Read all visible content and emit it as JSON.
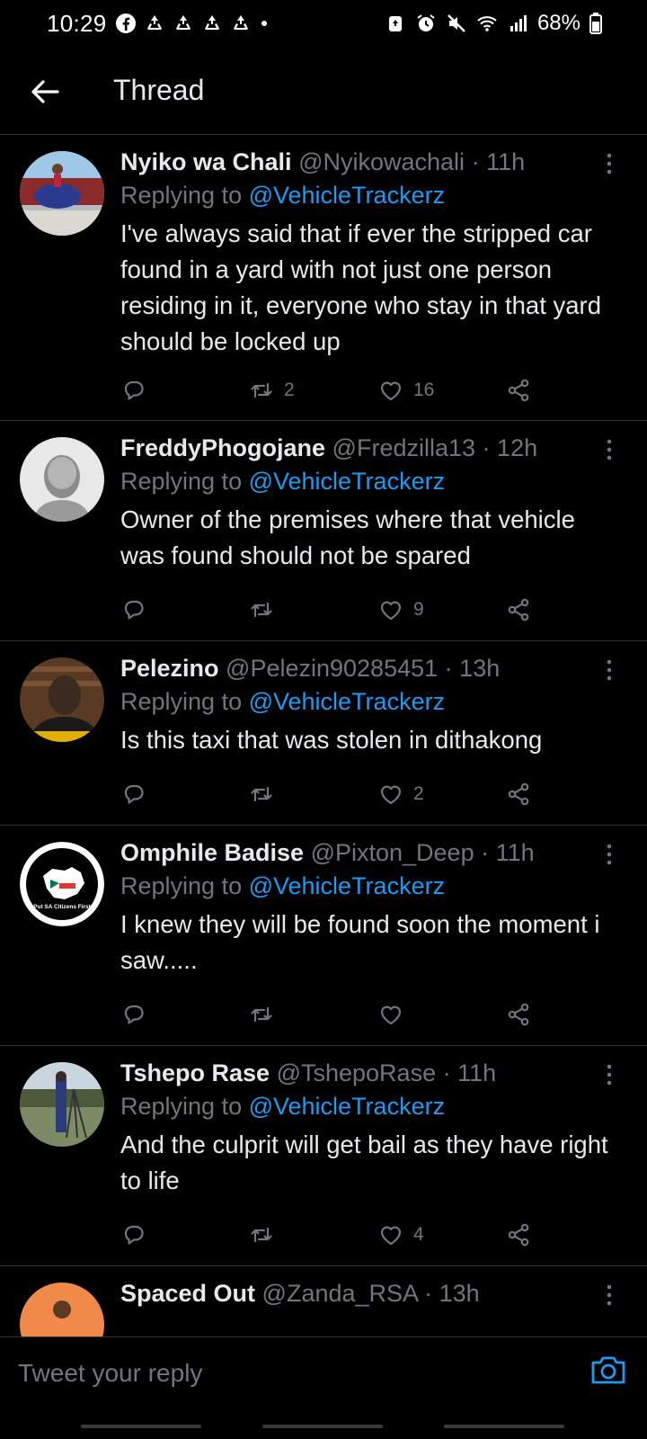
{
  "status_bar": {
    "time": "10:29",
    "battery": "68%",
    "left_icons": [
      "facebook-icon",
      "recycle-icon",
      "recycle-icon",
      "recycle-icon",
      "recycle-icon",
      "dot-icon"
    ],
    "right_icons": [
      "battery-saver-icon",
      "alarm-icon",
      "mute-icon",
      "wifi-icon",
      "signal-icon",
      "battery-icon"
    ]
  },
  "header": {
    "title": "Thread"
  },
  "tweets": [
    {
      "name": "Nyiko wa Chali",
      "handle": "@Nyikowachali",
      "sep": "·",
      "time": "11h",
      "replying_prefix": "Replying to ",
      "replying_to": "@VehicleTrackerz",
      "text": "I've always said that if ever the stripped car found in a yard with not just one person residing in it, everyone who stay in that yard should be locked up",
      "retweets": "2",
      "likes": "16"
    },
    {
      "name": "FreddyPhogojane",
      "handle": "@Fredzilla13",
      "sep": "·",
      "time": "12h",
      "replying_prefix": "Replying to ",
      "replying_to": "@VehicleTrackerz",
      "text": "Owner of the premises where that vehicle was found should not be spared",
      "retweets": "",
      "likes": "9"
    },
    {
      "name": "Pelezino",
      "handle": "@Pelezin90285451",
      "sep": "·",
      "time": "13h",
      "replying_prefix": "Replying to ",
      "replying_to": "@VehicleTrackerz",
      "text": "Is this taxi that was stolen in dithakong",
      "retweets": "",
      "likes": "2"
    },
    {
      "name": "Omphile Badise",
      "handle": "@Pixton_Deep",
      "sep": "·",
      "time": "11h",
      "replying_prefix": "Replying to ",
      "replying_to": "@VehicleTrackerz",
      "text": "I knew they will be found soon the moment i saw.....",
      "retweets": "",
      "likes": "",
      "avatar_text": "Put SA Citizens First"
    },
    {
      "name": "Tshepo Rase",
      "handle": "@TshepoRase",
      "sep": "·",
      "time": "11h",
      "replying_prefix": "Replying to ",
      "replying_to": "@VehicleTrackerz",
      "text": "And the culprit will get bail as they have right to life",
      "retweets": "",
      "likes": "4"
    },
    {
      "name": "Spaced Out",
      "handle": "@Zanda_RSA",
      "sep": "·",
      "time": "13h"
    }
  ],
  "composer": {
    "placeholder": "Tweet your reply"
  },
  "colors": {
    "background": "#000000",
    "text": "#e7e9ea",
    "muted": "#71767b",
    "accent": "#1d9bf0",
    "divider": "#2f3336"
  }
}
